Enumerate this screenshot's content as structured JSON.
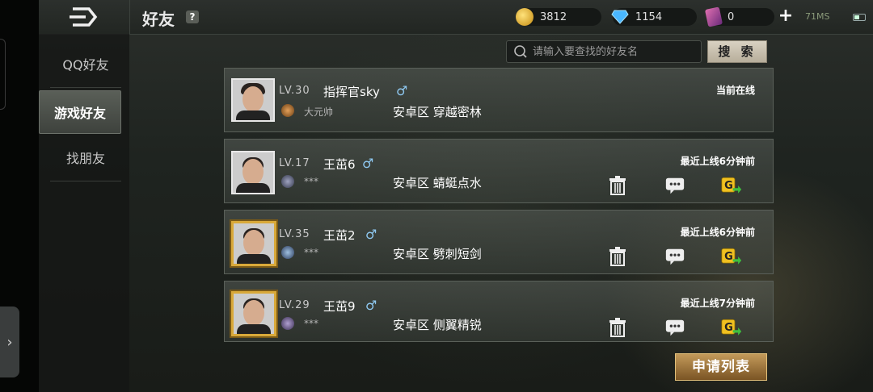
{
  "header": {
    "title": "好友",
    "help_label": "?",
    "gold": "3812",
    "diamond": "1154",
    "card": "0",
    "plus_label": "+",
    "fps": "71MS"
  },
  "nav": {
    "items": [
      {
        "label": "QQ好友"
      },
      {
        "label": "游戏好友"
      },
      {
        "label": "找朋友"
      }
    ]
  },
  "search": {
    "placeholder": "请输入要查找的好友名",
    "button_label": "搜 索"
  },
  "friends": [
    {
      "level": "LV.30",
      "name": "指挥官sky",
      "sex": "♂",
      "rank": "大元帅",
      "zone": "安卓区",
      "map": "穿越密林",
      "status": "当前在线"
    },
    {
      "level": "LV.17",
      "name": "王茁6",
      "sex": "♂",
      "rank": "***",
      "zone": "安卓区",
      "map": "蜻蜓点水",
      "status": "最近上线6分钟前"
    },
    {
      "level": "LV.35",
      "name": "王茁2",
      "sex": "♂",
      "rank": "***",
      "zone": "安卓区",
      "map": "劈刺短剑",
      "status": "最近上线6分钟前"
    },
    {
      "level": "LV.29",
      "name": "王茁9",
      "sex": "♂",
      "rank": "***",
      "zone": "安卓区",
      "map": "侧翼精锐",
      "status": "最近上线7分钟前"
    }
  ],
  "apply_label": "申请列表",
  "edge_arrow": "›"
}
